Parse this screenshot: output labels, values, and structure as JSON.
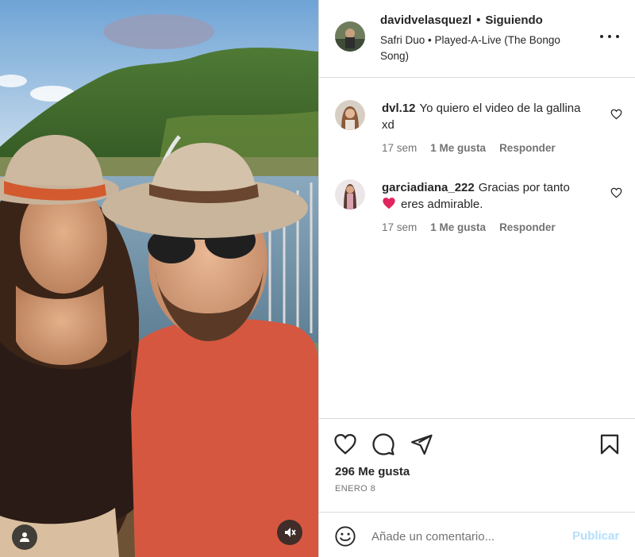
{
  "post": {
    "username": "davidvelasquezl",
    "separator": "•",
    "follow_status": "Siguiendo",
    "audio": "Safri Duo • Played-A-Live (The Bongo Song)",
    "more_icon": "more-options-icon"
  },
  "comments": [
    {
      "username": "dvl.12",
      "text": "Yo quiero el video de la gallina xd",
      "time": "17 sem",
      "likes": "1 Me gusta",
      "reply": "Responder"
    },
    {
      "username": "garciadiana_222",
      "text_before": "Gracias por tanto",
      "text_after": "eres admirable.",
      "time": "17 sem",
      "likes": "1 Me gusta",
      "reply": "Responder"
    }
  ],
  "actions": {
    "like_icon": "heart-outline-icon",
    "comment_icon": "comment-bubble-icon",
    "share_icon": "paper-plane-icon",
    "save_icon": "bookmark-icon",
    "likes_count": "296 Me gusta",
    "date": "ENERO 8"
  },
  "add_comment": {
    "placeholder": "Añade un comentario...",
    "publish_label": "Publicar",
    "emoji_icon": "emoji-smile-icon"
  },
  "colors": {
    "text_primary": "#262626",
    "text_secondary": "#737373",
    "divider": "#dbdbdb",
    "publish_disabled": "#b2dffc",
    "heart_red": "#e0245e"
  }
}
